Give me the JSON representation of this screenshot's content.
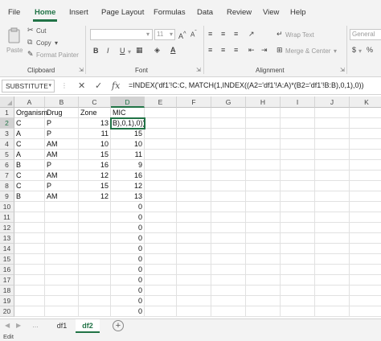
{
  "menu": {
    "tabs": [
      {
        "label": "File"
      },
      {
        "label": "Home"
      },
      {
        "label": "Insert"
      },
      {
        "label": "Page Layout"
      },
      {
        "label": "Formulas"
      },
      {
        "label": "Data"
      },
      {
        "label": "Review"
      },
      {
        "label": "View"
      },
      {
        "label": "Help"
      }
    ],
    "active_color": "#217346"
  },
  "ribbon": {
    "clipboard": {
      "paste": "Paste",
      "cut": "Cut",
      "copy": "Copy",
      "format_painter": "Format Painter",
      "label": "Clipboard"
    },
    "font": {
      "size": "11",
      "grow": "A",
      "shrink": "A",
      "bold": "B",
      "italic": "I",
      "underline": "U",
      "label": "Font"
    },
    "alignment": {
      "wrap_text": "Wrap Text",
      "merge_center": "Merge & Center",
      "label": "Alignment"
    },
    "number": {
      "format": "General"
    }
  },
  "formula_bar": {
    "name_box": "SUBSTITUTE",
    "cancel": "✕",
    "enter": "✓",
    "fx": "fx",
    "formula": "=INDEX('df1'!C:C, MATCH(1,INDEX((A2='df1'!A:A)*(B2='df1'!B:B),0,1),0))"
  },
  "grid": {
    "columns": [
      "A",
      "B",
      "C",
      "D",
      "E",
      "F",
      "G",
      "H",
      "I",
      "J",
      "K"
    ],
    "rows": [
      "1",
      "2",
      "3",
      "4",
      "5",
      "6",
      "7",
      "8",
      "9",
      "10",
      "11",
      "12",
      "13",
      "14",
      "15",
      "16",
      "17",
      "18",
      "19",
      "20"
    ],
    "header_row": [
      "Organism",
      "Drug",
      "Zone",
      "MIC"
    ],
    "data": [
      [
        "C",
        "P",
        "13",
        "B),0,1),0))"
      ],
      [
        "A",
        "P",
        "11",
        "15"
      ],
      [
        "C",
        "AM",
        "10",
        "10"
      ],
      [
        "A",
        "AM",
        "15",
        "11"
      ],
      [
        "B",
        "P",
        "16",
        "9"
      ],
      [
        "C",
        "AM",
        "12",
        "16"
      ],
      [
        "C",
        "P",
        "15",
        "12"
      ],
      [
        "B",
        "AM",
        "12",
        "13"
      ],
      [
        "",
        "",
        "",
        "0"
      ],
      [
        "",
        "",
        "",
        "0"
      ],
      [
        "",
        "",
        "",
        "0"
      ],
      [
        "",
        "",
        "",
        "0"
      ],
      [
        "",
        "",
        "",
        "0"
      ],
      [
        "",
        "",
        "",
        "0"
      ],
      [
        "",
        "",
        "",
        "0"
      ],
      [
        "",
        "",
        "",
        "0"
      ],
      [
        "",
        "",
        "",
        "0"
      ],
      [
        "",
        "",
        "",
        "0"
      ],
      [
        "",
        "",
        "",
        "0"
      ]
    ]
  },
  "sheets": {
    "tabs": [
      {
        "label": "df1"
      },
      {
        "label": "df2"
      }
    ],
    "add": "+"
  },
  "status": {
    "mode": "Edit"
  }
}
